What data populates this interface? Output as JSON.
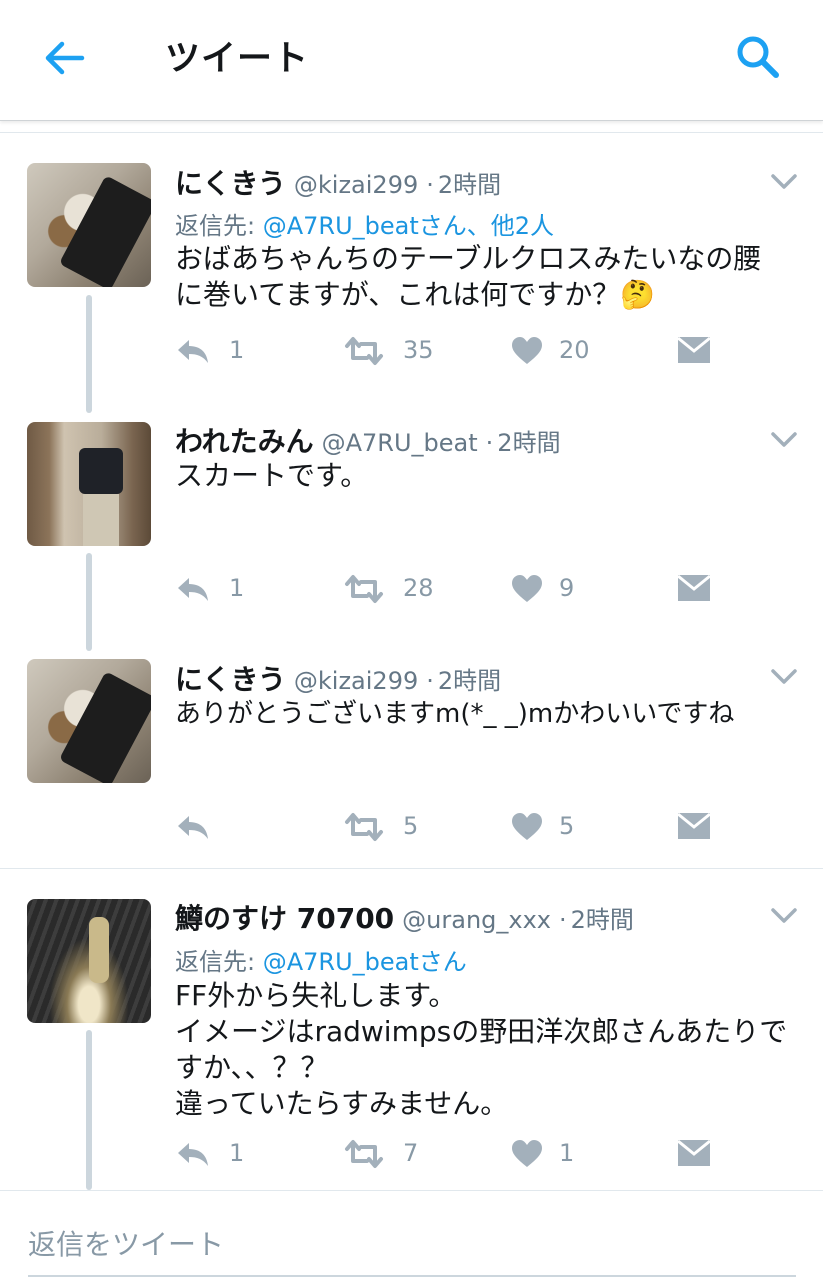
{
  "header": {
    "title": "ツイート",
    "accent_color": "#1da1f2"
  },
  "tweets": [
    {
      "name": "にくきう",
      "handle": "@kizai299",
      "sep": "·",
      "time": "2時間",
      "reply_prefix": "返信先: ",
      "reply_to": "@A7RU_beatさん、他2人",
      "text_lines": [
        "おばあちゃんちのテーブルクロスみたいなの腰",
        "に巻いてますが、これは何ですか？🤔"
      ],
      "replies": "1",
      "retweets": "35",
      "likes": "20",
      "avatar": "cat-avatar"
    },
    {
      "name": "われたみん",
      "handle": "@A7RU_beat",
      "sep": "·",
      "time": "2時間",
      "text_lines": [
        "スカートです。"
      ],
      "replies": "1",
      "retweets": "28",
      "likes": "9",
      "avatar": "mirror-selfie-avatar"
    },
    {
      "name": "にくきう",
      "handle": "@kizai299",
      "sep": "·",
      "time": "2時間",
      "text_lines": [
        "ありがとうございますm(*_ _)mかわいいですね"
      ],
      "replies": "",
      "retweets": "5",
      "likes": "5",
      "avatar": "cat-avatar"
    },
    {
      "name": "鱒のすけ 70700",
      "handle": "@urang_xxx",
      "sep": "·",
      "time": "2時間",
      "reply_prefix": "返信先: ",
      "reply_to": "@A7RU_beatさん",
      "text_lines": [
        "FF外から失礼します。",
        "イメージはradwimpsの野田洋次郎さんあたりで",
        "すか、、？？",
        "違っていたらすみません。"
      ],
      "replies": "1",
      "retweets": "7",
      "likes": "1",
      "avatar": "dark-photo-avatar"
    }
  ],
  "reply_bar": {
    "placeholder": "返信をツイート"
  }
}
